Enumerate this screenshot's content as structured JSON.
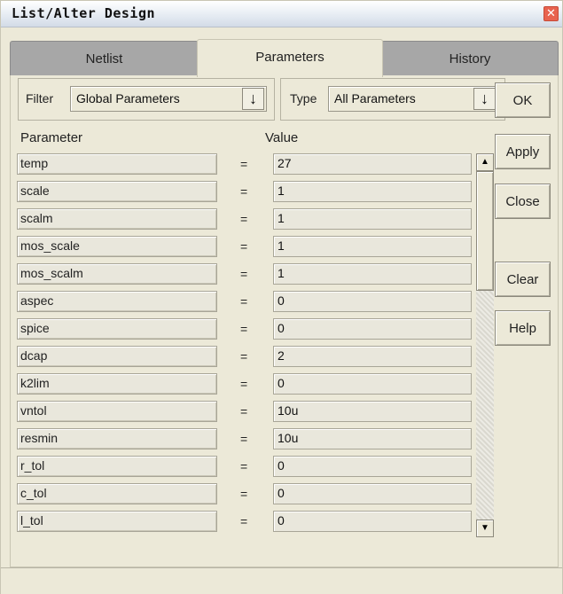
{
  "window": {
    "title": "List/Alter Design",
    "close_glyph": "✕"
  },
  "tabs": [
    {
      "label": "Netlist",
      "active": false
    },
    {
      "label": "Parameters",
      "active": true
    },
    {
      "label": "History",
      "active": false
    }
  ],
  "filter": {
    "label": "Filter",
    "value": "Global Parameters"
  },
  "type": {
    "label": "Type",
    "value": "All Parameters"
  },
  "columns": {
    "parameter": "Parameter",
    "value": "Value"
  },
  "equals": "=",
  "rows": [
    {
      "name": "temp",
      "value": "27"
    },
    {
      "name": "scale",
      "value": "1"
    },
    {
      "name": "scalm",
      "value": "1"
    },
    {
      "name": "mos_scale",
      "value": "1"
    },
    {
      "name": "mos_scalm",
      "value": "1"
    },
    {
      "name": "aspec",
      "value": "0"
    },
    {
      "name": "spice",
      "value": "0"
    },
    {
      "name": "dcap",
      "value": "2"
    },
    {
      "name": "k2lim",
      "value": "0"
    },
    {
      "name": "vntol",
      "value": "10u"
    },
    {
      "name": "resmin",
      "value": "10u"
    },
    {
      "name": "r_tol",
      "value": "0"
    },
    {
      "name": "c_tol",
      "value": "0"
    },
    {
      "name": "l_tol",
      "value": "0"
    }
  ],
  "buttons": {
    "ok": "OK",
    "apply": "Apply",
    "close": "Close",
    "clear": "Clear",
    "help": "Help"
  },
  "icons": {
    "dropdown": "arrow-down-icon",
    "scroll_up": "scroll-up-icon",
    "scroll_down": "scroll-down-icon"
  },
  "colors": {
    "window_bg": "#ece9d8",
    "close_button": "#e8634f",
    "inactive_tab": "#a7a7a7"
  }
}
